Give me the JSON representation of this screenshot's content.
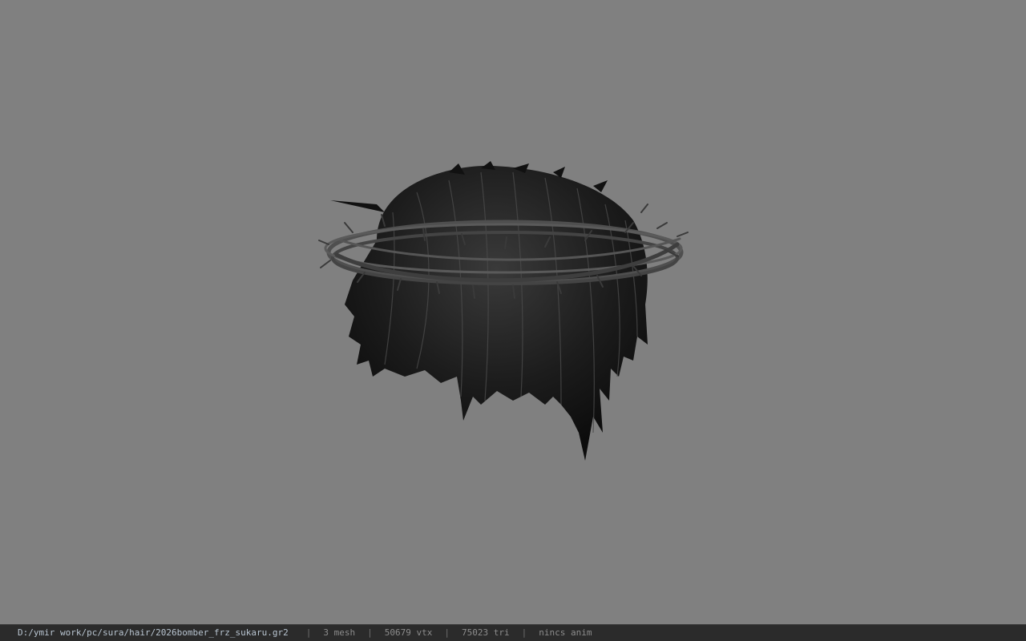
{
  "viewport": {
    "background_color": "#808080",
    "model": "hair-with-crown-of-thorns"
  },
  "statusbar": {
    "path": "D:/ymir work/pc/sura/hair/2026bomber_frz_sukaru.gr2",
    "separator": "|",
    "mesh": "3 mesh",
    "vtx": "50679 vtx",
    "tri": "75023 tri",
    "anim": "nincs anim",
    "background_color": "#2b2b2b",
    "text_color": "#8c8c8c"
  }
}
